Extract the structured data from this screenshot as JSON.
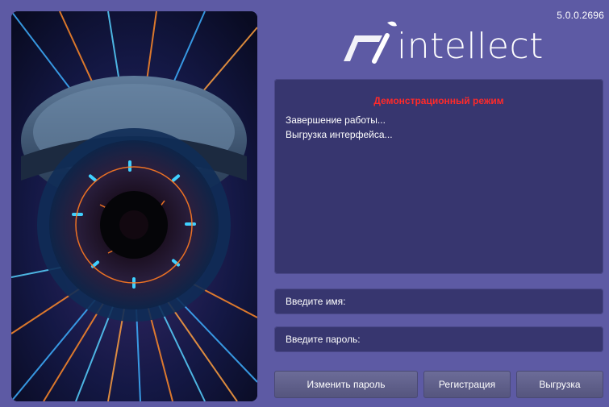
{
  "window": {
    "version": "5.0.0.2696",
    "logo_text": "intellect"
  },
  "log": {
    "warning": "Демонстрационный режим",
    "lines": [
      "Завершение работы...",
      "Выгрузка интерфейса..."
    ]
  },
  "login": {
    "name_placeholder": "Введите имя:",
    "password_placeholder": "Введите пароль:"
  },
  "buttons": {
    "change_password": "Изменить пароль",
    "register": "Регистрация",
    "unload": "Выгрузка"
  },
  "colors": {
    "background": "#5d5aa4",
    "panel": "#37366f",
    "warning": "#ff2a2a"
  },
  "icons": [
    "camera-dome-illustration",
    "intellect-logo-icon"
  ]
}
